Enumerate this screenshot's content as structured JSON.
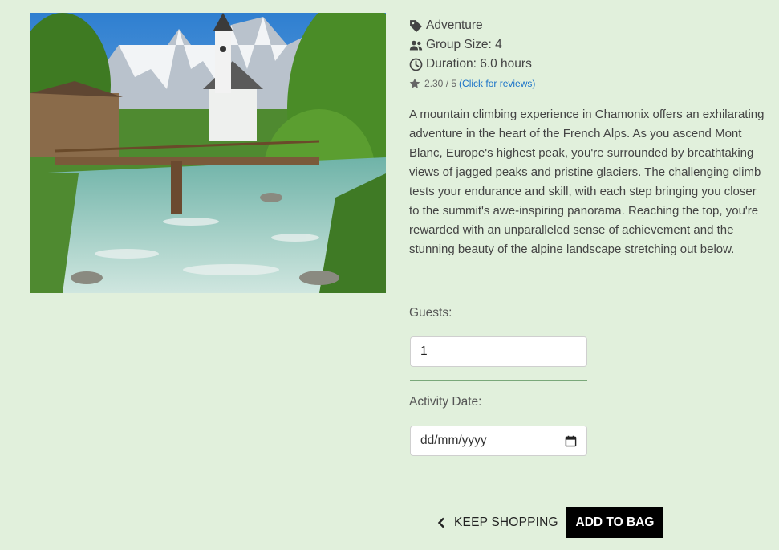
{
  "product": {
    "category": "Adventure",
    "group_size": "Group Size: 4",
    "duration": "Duration: 6.0 hours",
    "rating_text": "2.30 / 5",
    "reviews_link": "(Click for reviews)",
    "description": "A mountain climbing experience in Chamonix offers an exhilarating adventure in the heart of the French Alps. As you ascend Mont Blanc, Europe's highest peak, you're surrounded by breathtaking views of jagged peaks and pristine glaciers. The challenging climb tests your endurance and skill, with each step bringing you closer to the summit's awe-inspiring panorama. Reaching the top, you're rewarded with an unparalleled sense of achievement and the stunning beauty of the alpine landscape stretching out below."
  },
  "form": {
    "guests_label": "Guests:",
    "guests_value": "1",
    "date_label": "Activity Date:",
    "date_placeholder": "dd/mm/yyyy"
  },
  "actions": {
    "keep_shopping": "KEEP SHOPPING",
    "add_to_bag": "ADD TO BAG"
  },
  "icons": {
    "category": "tag-icon",
    "group": "users-icon",
    "duration": "clock-icon",
    "rating": "star-icon",
    "date": "calendar-icon",
    "back": "chevron-left-icon"
  }
}
